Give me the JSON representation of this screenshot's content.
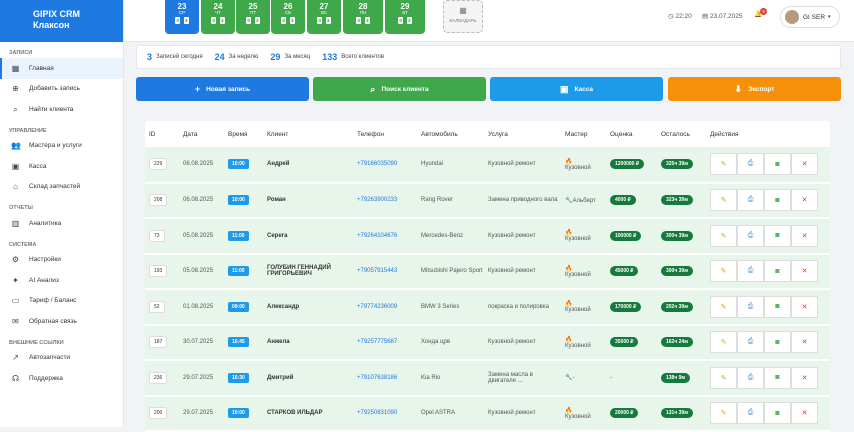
{
  "brand": {
    "title": "GIPIX CRM",
    "subtitle": "Клаксон"
  },
  "sidebar": [
    {
      "section": "ЗАПИСИ",
      "items": [
        {
          "label": "Главная",
          "icon": "dashboard-icon",
          "active": true
        },
        {
          "label": "Добавить запись",
          "icon": "plus-circle-icon"
        },
        {
          "label": "Найти клиента",
          "icon": "search-icon"
        }
      ]
    },
    {
      "section": "УПРАВЛЕНИЕ",
      "items": [
        {
          "label": "Мастера и услуги",
          "icon": "users-icon"
        },
        {
          "label": "Касса",
          "icon": "cash-icon"
        },
        {
          "label": "Склад запчастей",
          "icon": "warehouse-icon"
        }
      ]
    },
    {
      "section": "ОТЧЕТЫ",
      "items": [
        {
          "label": "Аналитика",
          "icon": "chart-icon"
        }
      ]
    },
    {
      "section": "СИСТЕМА",
      "items": [
        {
          "label": "Настройки",
          "icon": "gear-icon"
        },
        {
          "label": "AI Анализ",
          "icon": "sparkle-icon"
        },
        {
          "label": "Тариф / Баланс",
          "icon": "card-icon"
        },
        {
          "label": "Обратная связь",
          "icon": "mail-icon"
        }
      ]
    },
    {
      "section": "ВНЕШНИЕ ССЫЛКИ",
      "items": [
        {
          "label": "Автозапчасти",
          "icon": "external-link-icon"
        },
        {
          "label": "Поддержка",
          "icon": "headset-icon"
        }
      ]
    }
  ],
  "days": [
    {
      "num": "23",
      "dow": "СР",
      "badges": [
        "0",
        "3"
      ],
      "today": true
    },
    {
      "num": "24",
      "dow": "ЧТ",
      "badges": [
        "0",
        "3"
      ]
    },
    {
      "num": "25",
      "dow": "ПТ",
      "badges": [
        "0",
        "3"
      ]
    },
    {
      "num": "26",
      "dow": "СБ",
      "badges": [
        "0",
        "3"
      ]
    },
    {
      "num": "27",
      "dow": "ВС",
      "badges": [
        "0",
        "3"
      ]
    },
    {
      "num": "28",
      "dow": "ПН",
      "badges": [
        "0",
        "3"
      ]
    },
    {
      "num": "29",
      "dow": "ВТ",
      "badges": [
        "0",
        "3"
      ]
    }
  ],
  "calendar_label": "КАЛЕНДАРЬ",
  "header": {
    "time": "22:20",
    "date": "23.07.2025",
    "notif_count": "9",
    "user": "GI SER"
  },
  "stats": [
    {
      "value": "3",
      "label": "Записей сегодня"
    },
    {
      "value": "24",
      "label": "За неделю"
    },
    {
      "value": "29",
      "label": "За месяц"
    },
    {
      "value": "133",
      "label": "Всего клиентов"
    }
  ],
  "actions": [
    {
      "label": "Новая запись",
      "icon": "plus-icon",
      "color": "#1e7ae0"
    },
    {
      "label": "Поиск клиента",
      "icon": "search-icon",
      "color": "#3ea84a"
    },
    {
      "label": "Касса",
      "icon": "cash-icon",
      "color": "#1e9be8"
    },
    {
      "label": "Экспорт",
      "icon": "download-icon",
      "color": "#f5900a"
    }
  ],
  "table": {
    "headers": [
      "ID",
      "Дата",
      "Время",
      "Клиент",
      "Телефон",
      "Автомобиль",
      "Услуга",
      "Мастер",
      "Оценка",
      "Осталось",
      "Действия"
    ],
    "rows": [
      {
        "id": "229",
        "date": "06.08.2025",
        "time": "10:00",
        "client": "Андрей",
        "phone": "+79166035090",
        "car": "Hyundai",
        "service": "Кузовной ремонт",
        "master": "Кузовной",
        "master_icon": "fire-icon",
        "estimate": "1200000 ₽",
        "left": "325ч 39м"
      },
      {
        "id": "208",
        "date": "06.08.2025",
        "time": "10:00",
        "client": "Роман",
        "phone": "+79263900233",
        "car": "Rang Rover",
        "service": "Замена приводного вала",
        "master": "Альберт",
        "master_icon": "wrench-icon",
        "estimate": "4000 ₽",
        "left": "323ч 39м"
      },
      {
        "id": "73",
        "date": "05.08.2025",
        "time": "11:00",
        "client": "Серега",
        "phone": "+79264104676",
        "car": "Mercedes-Benz",
        "service": "Кузовной ремонт",
        "master": "Кузовной",
        "master_icon": "fire-icon",
        "estimate": "100000 ₽",
        "left": "300ч 39м"
      },
      {
        "id": "193",
        "date": "05.08.2025",
        "time": "11:00",
        "client": "ГОЛУБИН ГЕННАДИЙ ГРИГОРЬЕВИЧ",
        "phone": "+79057915443",
        "car": "Mitsubishi Pajero Sport",
        "service": "Кузовной ремонт",
        "master": "Кузовной",
        "master_icon": "fire-icon",
        "estimate": "45000 ₽",
        "left": "300ч 39м"
      },
      {
        "id": "52",
        "date": "01.08.2025",
        "time": "09:00",
        "client": "Александр",
        "phone": "+79774236009",
        "car": "BMW 3 Series",
        "service": "покраска и полировка",
        "master": "Кузовной",
        "master_icon": "fire-icon",
        "estimate": "170000 ₽",
        "left": "202ч 39м"
      },
      {
        "id": "187",
        "date": "30.07.2025",
        "time": "16:45",
        "client": "Анжела",
        "phone": "+79257775687",
        "car": "Хонда црв",
        "service": "Кузовной ремонт",
        "master": "Кузовной",
        "master_icon": "fire-icon",
        "estimate": "35000 ₽",
        "left": "162ч 24м"
      },
      {
        "id": "236",
        "date": "29.07.2025",
        "time": "16:30",
        "client": "Дмитрий",
        "phone": "+79107638186",
        "car": "Kia Rio",
        "service": "Замена масла в двигателе ...",
        "master": "-",
        "master_icon": "wrench-icon",
        "estimate": "-",
        "left": "138ч 9м"
      },
      {
        "id": "200",
        "date": "29.07.2025",
        "time": "10:00",
        "client": "СТАРКОВ ИЛЬДАР",
        "phone": "+79250831090",
        "car": "Opel ASTRA",
        "service": "Кузовной ремонт",
        "master": "Кузовной",
        "master_icon": "fire-icon",
        "estimate": "20000 ₽",
        "left": "131ч 39м"
      }
    ]
  }
}
